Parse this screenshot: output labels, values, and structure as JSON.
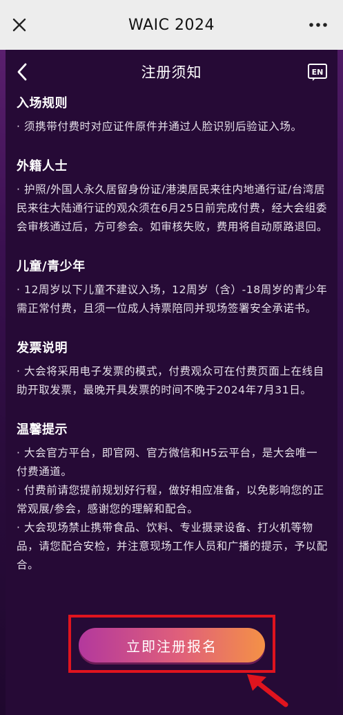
{
  "topbar": {
    "title": "WAIC 2024",
    "close_icon": "close-icon",
    "more_icon": "more-icon"
  },
  "header": {
    "title": "注册须知",
    "back_icon": "chevron-left-icon",
    "lang_icon": "en-language-icon",
    "lang_label": "EN"
  },
  "sections": [
    {
      "title": "入场规则",
      "paragraphs": [
        "· 须携带付费时对应证件原件并通过人脸识别后验证入场。"
      ]
    },
    {
      "title": "外籍人士",
      "paragraphs": [
        "· 护照/外国人永久居留身份证/港澳居民来往内地通行证/台湾居民来往大陆通行证的观众须在6月25日前完成付费，经大会组委会审核通过后，方可参会。如审核失败，费用将自动原路退回。"
      ]
    },
    {
      "title": "儿童/青少年",
      "paragraphs": [
        "· 12周岁以下儿童不建议入场，12周岁（含）-18周岁的青少年需正常付费，且须一位成人持票陪同并现场签署安全承诺书。"
      ]
    },
    {
      "title": "发票说明",
      "paragraphs": [
        "· 大会将采用电子发票的模式，付费观众可在付费页面上在线自助开取发票，最晚开具发票的时间不晚于2024年7月31日。"
      ]
    },
    {
      "title": "温馨提示",
      "paragraphs": [
        "· 大会官方平台，即官网、官方微信和H5云平台，是大会唯一付费通道。",
        "· 付费前请您提前规划好行程，做好相应准备，以免影响您的正常观展/参会，感谢您的理解和配合。",
        "· 大会现场禁止携带食品、饮料、专业摄录设备、打火机等物品，请您配合安检，并注意现场工作人员和广播的提示，予以配合。"
      ]
    }
  ],
  "cta": {
    "label": "立即注册报名"
  },
  "colors": {
    "background": "#260a36",
    "highlight_frame": "#e0141e",
    "button_gradient_start": "#b3389d",
    "button_gradient_end": "#f49146"
  }
}
